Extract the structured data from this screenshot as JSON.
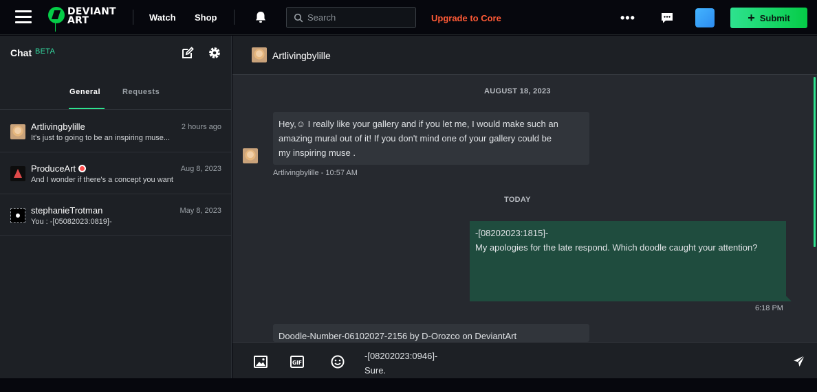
{
  "header": {
    "logo_text_line1": "DEVIANT",
    "logo_text_line2": "ART",
    "watch_label": "Watch",
    "shop_label": "Shop",
    "search_placeholder": "Search",
    "upgrade_label": "Upgrade to Core",
    "more_label": "•••",
    "submit_label": "Submit"
  },
  "sidebar": {
    "title": "Chat",
    "beta": "BETA",
    "tabs": [
      {
        "label": "General"
      },
      {
        "label": "Requests"
      }
    ],
    "conversations": [
      {
        "name": "Artlivingbylille",
        "time": "2 hours ago",
        "preview": "It's just to going to be an inspiring muse..."
      },
      {
        "name": "ProduceArt",
        "time": "Aug 8, 2023",
        "preview": "And I wonder if there's a concept you want"
      },
      {
        "name": "stephanieTrotman",
        "time": "May 8, 2023",
        "preview": "You : -[05082023:0819]-"
      }
    ]
  },
  "chat": {
    "recipient": "Artlivingbylille",
    "date1": "AUGUST 18, 2023",
    "msg1": {
      "line1": "Hey,☺ I really like your gallery and if you let me, I would make such an",
      "line2": "amazing mural out of it! If you don't mind one of your gallery could be",
      "line3": "my inspiring muse .",
      "meta": "Artlivingbylille  - 10:57 AM"
    },
    "date2": "TODAY",
    "msg2": {
      "line1": "-[08202023:1815]-",
      "line2": "My apologies for the late respond. Which doodle caught your attention?",
      "time": "6:18 PM"
    },
    "msg3": {
      "text": "Doodle-Number-06102027-2156  by D-Orozco on DeviantArt"
    },
    "composer": {
      "line1": "-[08202023:0946]-",
      "line2": "Sure."
    }
  },
  "colors": {
    "accent_green": "#2ee28f",
    "upgrade_red": "#ff5a36",
    "beta_teal": "#34d9a0",
    "outgoing_bubble": "#1f4c3e"
  }
}
